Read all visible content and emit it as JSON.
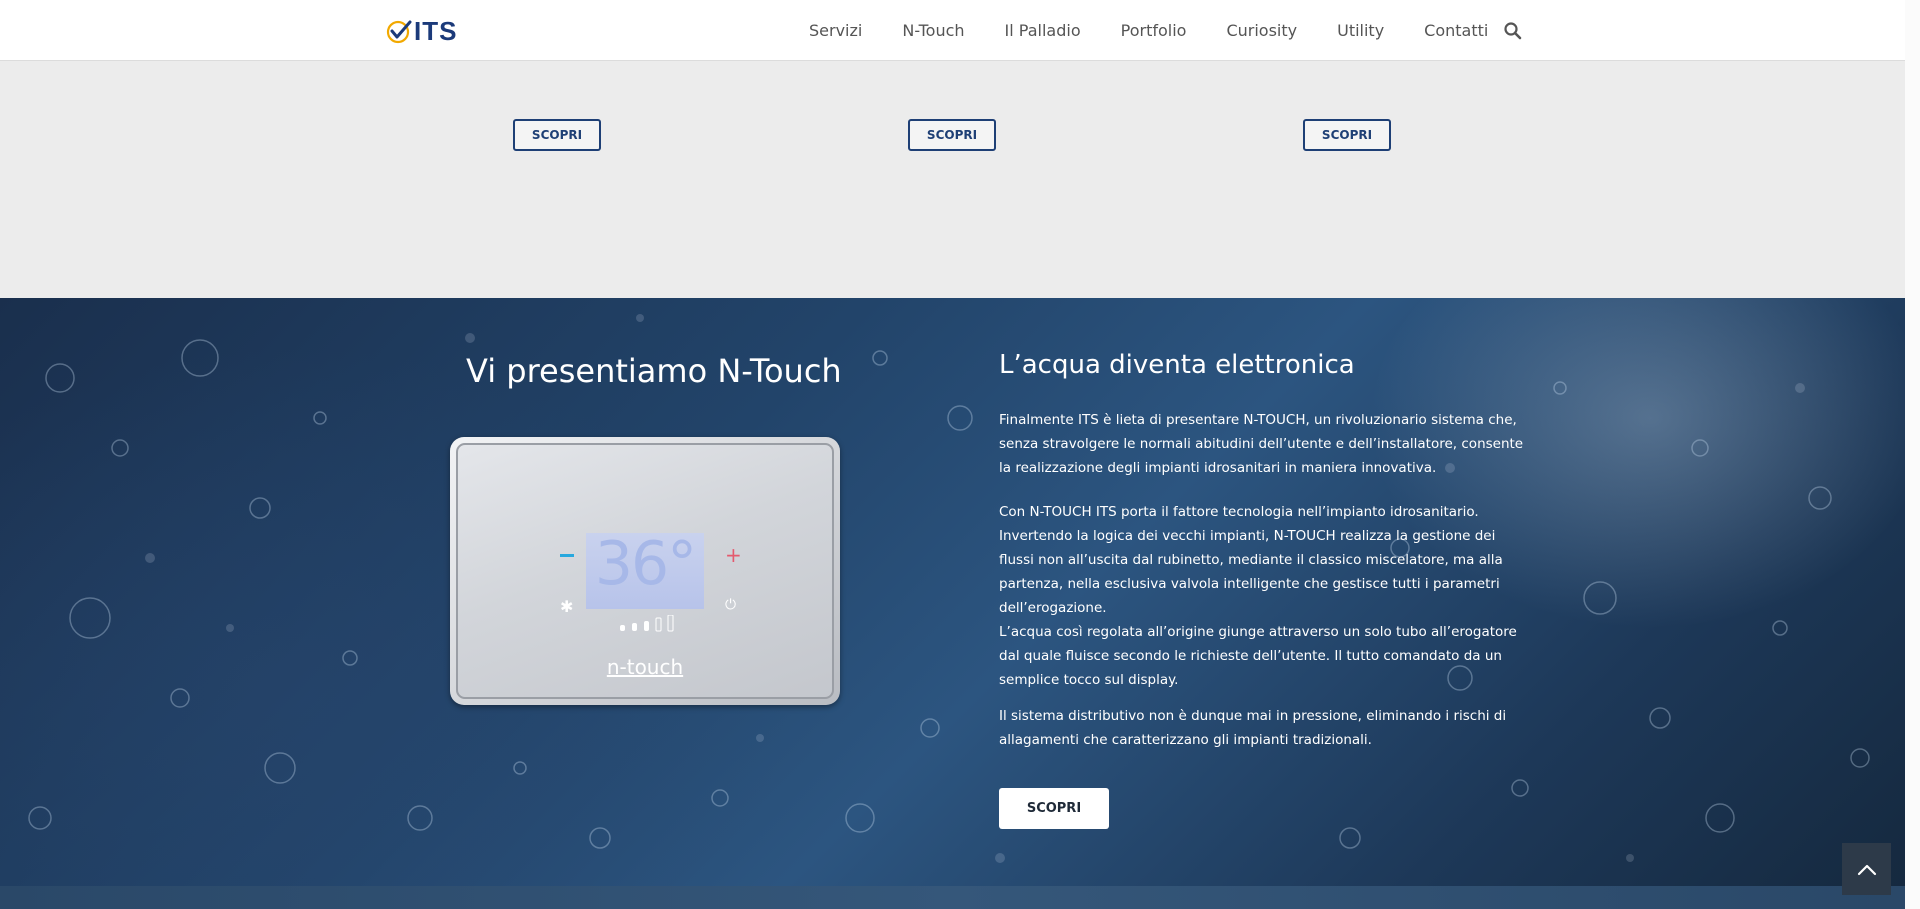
{
  "header": {
    "logo_text": "ITS",
    "nav": [
      "Servizi",
      "N-Touch",
      "Il Palladio",
      "Portfolio",
      "Curiosity",
      "Utility",
      "Contatti"
    ],
    "search_icon": "search-icon"
  },
  "cards": {
    "buttons": [
      "SCOPRI",
      "SCOPRI",
      "SCOPRI"
    ]
  },
  "hero": {
    "left_title": "Vi presentiamo N-Touch",
    "right_title": "L’acqua diventa elettronica",
    "p1": "Finalmente ITS è lieta di presentare N-TOUCH, un rivoluzionario sistema che, senza stravolgere le normali abitudini dell’utente e dell’installatore, consente la realizzazione degli impianti idrosanitari in maniera innovativa.",
    "p2": "Con N-TOUCH ITS porta il fattore tecnologia nell’impianto idrosanitario. Invertendo la logica dei vecchi impianti, N-TOUCH realizza la gestione dei flussi non all’uscita dal rubinetto, mediante il classico miscelatore, ma alla partenza, nella esclusiva valvola intelligente che gestisce tutti i parametri dell’erogazione.",
    "p2b": "L’acqua così regolata all’origine giunge attraverso un solo tubo all’erogatore dal quale fluisce secondo le richieste dell’utente. Il tutto comandato da un semplice tocco sul display.",
    "p3": "Il sistema distributivo non è dunque mai in pressione, eliminando i rischi di allagamenti che caratterizzano gli impianti tradizionali.",
    "button": "SCOPRI",
    "device": {
      "temperature": "36°",
      "brand": "n-touch",
      "minus_symbol": "−",
      "plus_symbol": "+",
      "snow_symbol": "✱",
      "power_symbol": "⏻"
    }
  },
  "colors": {
    "brand_blue": "#1e3f75",
    "accent_cyan": "#27a8de",
    "accent_red": "#e45a6e"
  },
  "icons": {
    "back_to_top": "chevron-up-icon"
  }
}
